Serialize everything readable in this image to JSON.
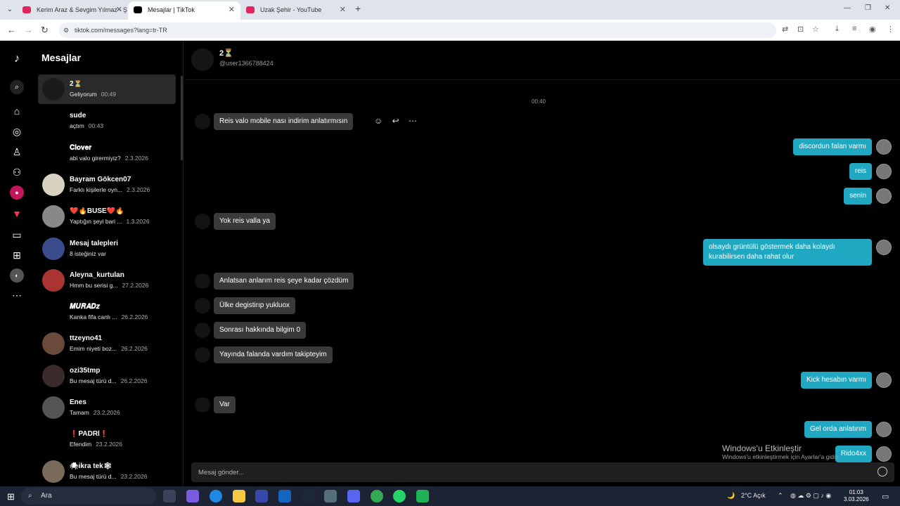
{
  "browser": {
    "tabs": [
      {
        "title": "Kerim Araz & Sevgim Yılmaz - Ş",
        "color": "#e0245e"
      },
      {
        "title": "Mesajlar | TikTok",
        "color": "#000000"
      },
      {
        "title": "Uzak Şehir - YouTube",
        "color": "#e0245e"
      }
    ],
    "url": "tiktok.com/messages?lang=tr-TR"
  },
  "sidebar": {
    "title": "Mesajlar"
  },
  "conversations": [
    {
      "name": "2⏳",
      "preview": "Geliyorum",
      "time": "00:49",
      "selected": true
    },
    {
      "name": "sude",
      "preview": "açtım",
      "time": "00:43"
    },
    {
      "name": "𝐂𝐥𝐨𝐯𝐞𝐫",
      "preview": "abi valo girermiyiz?",
      "time": "2.3.2026"
    },
    {
      "name": "Bayram Gökcen07",
      "preview": "Farklı kişilerle oyn...",
      "time": "2.3.2026"
    },
    {
      "name": "❤️🔥BUSE❤️🔥",
      "preview": "Yaptığın şeyi bari ...",
      "time": "1.3.2026"
    },
    {
      "name": "Mesaj talepleri",
      "preview": "8 isteğiniz var",
      "time": ""
    },
    {
      "name": "Aleyna_kurtulan",
      "preview": "Hmm bu serisi g...",
      "time": "27.2.2026"
    },
    {
      "name": "𝑴𝑼𝑹𝑨𝑫𝒛",
      "preview": "Kanka fifa canlı ...",
      "time": "26.2.2026"
    },
    {
      "name": "ttzeyno41",
      "preview": "Emim niyeti boz...",
      "time": "26.2.2026"
    },
    {
      "name": "ozi35tmp",
      "preview": "Bu mesaj türü d...",
      "time": "26.2.2026"
    },
    {
      "name": "Enes",
      "preview": "Tamam",
      "time": "23.2.2026"
    },
    {
      "name": "❗PADRİ❗",
      "preview": "Efendim",
      "time": "23.2.2026"
    },
    {
      "name": "🕷ikra tek🕸",
      "preview": "Bu mesaj türü d...",
      "time": "23.2.2026"
    }
  ],
  "chat": {
    "name": "2⏳",
    "username": "@user1366788424",
    "time_separator": "00:40",
    "messages": [
      {
        "dir": "in",
        "text": "Reis valo mobile nası indirim anlatırmısın"
      },
      {
        "dir": "out",
        "text": "discordun falan varmı"
      },
      {
        "dir": "out",
        "text": "reis"
      },
      {
        "dir": "out",
        "text": "senin"
      },
      {
        "dir": "in",
        "text": "Yok reis valla ya"
      },
      {
        "dir": "out",
        "text": "olsaydı grüntülü göstermek daha kolaydı kurabilirsen daha rahat olur"
      },
      {
        "dir": "in",
        "text": "Anlatsan anlarım reis şeye kadar çözdüm"
      },
      {
        "dir": "in",
        "text": "Ülke degistirıp yukluox"
      },
      {
        "dir": "in",
        "text": "Sonrası hakkında bilgim 0"
      },
      {
        "dir": "in",
        "text": "Yayında falanda vardım takipteyim"
      },
      {
        "dir": "out",
        "text": "Kick hesabın varmı"
      },
      {
        "dir": "in",
        "text": "Var"
      },
      {
        "dir": "out",
        "text": "Gel orda anlatırım"
      },
      {
        "dir": "out",
        "text": "Rido4xx"
      }
    ],
    "composer_placeholder": "Mesaj gönder..."
  },
  "watermark": {
    "line1": "Windows'u Etkinleştir",
    "line2": "Windows'u etkinleştirmek için Ayarlar'a gidin."
  },
  "taskbar": {
    "search": "Ara",
    "weather": "2°C  Açık",
    "clock_time": "01:03",
    "clock_date": "3.03.2026"
  }
}
